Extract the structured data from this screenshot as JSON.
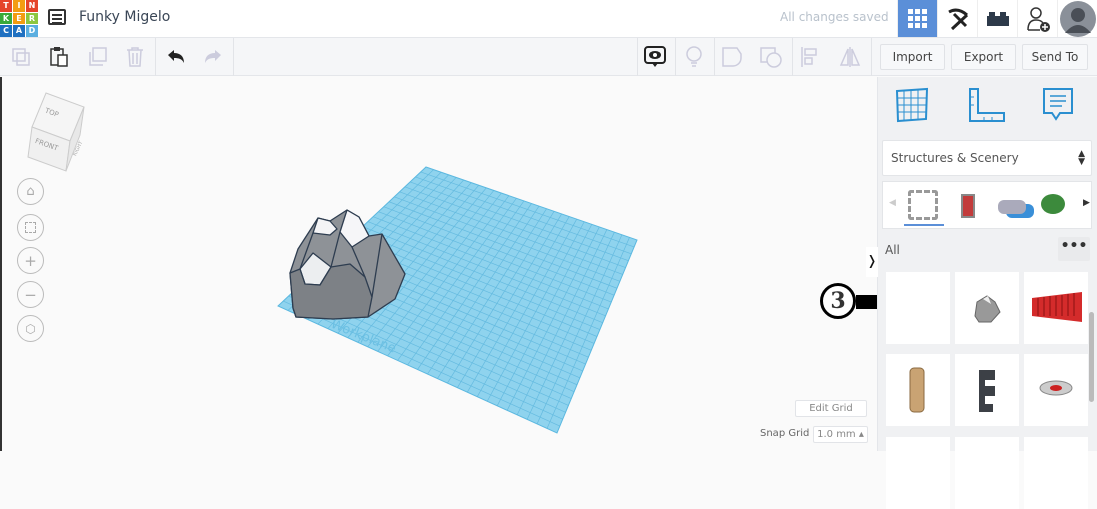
{
  "header": {
    "logo_letters": [
      "T",
      "I",
      "N",
      "K",
      "E",
      "R",
      "C",
      "A",
      "D"
    ],
    "logo_colors": [
      "#e5442a",
      "#f39c12",
      "#e5442a",
      "#3aa93a",
      "#f39c12",
      "#8cc63f",
      "#1f70c1",
      "#1f70c1",
      "#5aaee0"
    ],
    "title": "Funky Migelo",
    "status": "All changes saved",
    "accent": "#5b8fd8"
  },
  "toolbar": {
    "import": "Import",
    "export": "Export",
    "send_to": "Send To"
  },
  "viewcube": {
    "top": "TOP",
    "front": "FRONT",
    "right": "RIGHT"
  },
  "workplane": {
    "label": "Workplane"
  },
  "panel": {
    "category": "Structures & Scenery",
    "filter": "All",
    "more": "•••"
  },
  "annotation": {
    "step": "3"
  },
  "grid": {
    "edit_label": "Edit Grid",
    "snap_label": "Snap Grid",
    "snap_value": "1.0 mm ▴"
  }
}
